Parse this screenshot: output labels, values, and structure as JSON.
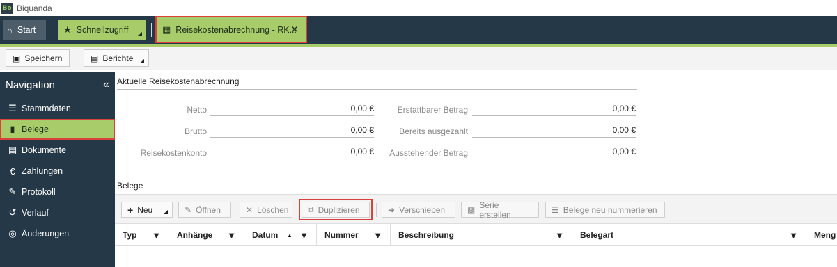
{
  "app": {
    "logo": "Bo",
    "title": "Biquanda"
  },
  "tabs": [
    {
      "label": "Start",
      "icon": "home-icon"
    },
    {
      "label": "Schnellzugriff",
      "icon": "star-icon"
    },
    {
      "label": "Reisekostenabrechnung - RK...",
      "icon": "building-icon",
      "close": "✕"
    }
  ],
  "toolbar": {
    "save_label": "Speichern",
    "reports_label": "Berichte"
  },
  "sidebar": {
    "title": "Navigation",
    "collapse": "«",
    "items": [
      {
        "label": "Stammdaten",
        "icon": "list-icon"
      },
      {
        "label": "Belege",
        "icon": "receipt-icon"
      },
      {
        "label": "Dokumente",
        "icon": "document-icon"
      },
      {
        "label": "Zahlungen",
        "icon": "euro-icon"
      },
      {
        "label": "Protokoll",
        "icon": "edit-icon"
      },
      {
        "label": "Verlauf",
        "icon": "history-icon"
      },
      {
        "label": "Änderungen",
        "icon": "fingerprint-icon"
      }
    ]
  },
  "summary": {
    "title": "Aktuelle Reisekostenabrechnung",
    "left": [
      {
        "label": "Netto",
        "value": "0,00 €"
      },
      {
        "label": "Brutto",
        "value": "0,00 €"
      },
      {
        "label": "Reisekostenkonto",
        "value": "0,00 €"
      }
    ],
    "right": [
      {
        "label": "Erstattbarer Betrag",
        "value": "0,00 €"
      },
      {
        "label": "Bereits ausgezahlt",
        "value": "0,00 €"
      },
      {
        "label": "Ausstehender Betrag",
        "value": "0,00 €"
      }
    ]
  },
  "belege": {
    "title": "Belege",
    "buttons": {
      "neu": "Neu",
      "oeffnen": "Öffnen",
      "loeschen": "Löschen",
      "duplizieren": "Duplizieren",
      "verschieben": "Verschieben",
      "serie": "Serie erstellen",
      "nummerieren": "Belege neu nummerieren"
    },
    "columns": [
      "Typ",
      "Anhänge",
      "Datum",
      "Nummer",
      "Beschreibung",
      "Belegart",
      "Meng"
    ]
  },
  "colors": {
    "dark": "#253847",
    "accent": "#a9cc6a",
    "highlight": "#d9413c"
  }
}
